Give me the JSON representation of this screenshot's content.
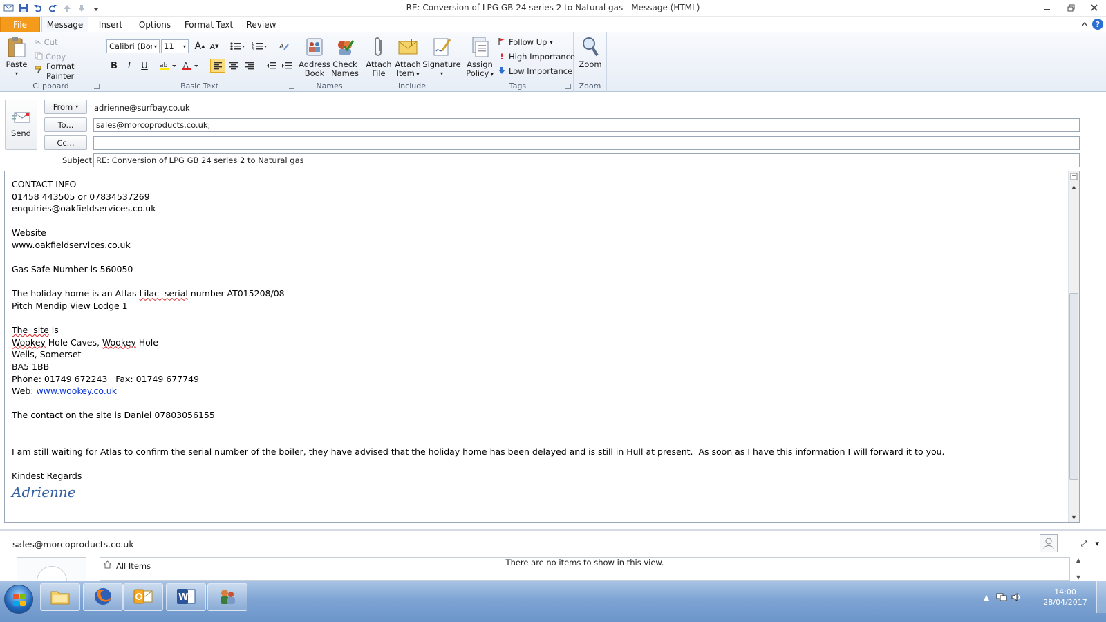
{
  "window": {
    "title": "RE: Conversion of LPG GB 24 series 2 to Natural gas  -  Message (HTML)"
  },
  "tabs": [
    "File",
    "Message",
    "Insert",
    "Options",
    "Format Text",
    "Review"
  ],
  "ribbon": {
    "clipboard": {
      "label": "Clipboard",
      "paste": "Paste",
      "cut": "Cut",
      "copy": "Copy",
      "format_painter": "Format Painter"
    },
    "basic_text": {
      "label": "Basic Text",
      "font_name": "Calibri (Body)",
      "font_size": "11"
    },
    "names": {
      "label": "Names",
      "address_book": [
        "Address",
        "Book"
      ],
      "check_names": [
        "Check",
        "Names"
      ]
    },
    "include": {
      "label": "Include",
      "attach_file": [
        "Attach",
        "File"
      ],
      "attach_item": [
        "Attach",
        "Item"
      ],
      "signature": "Signature"
    },
    "tags": {
      "label": "Tags",
      "assign_policy": [
        "Assign",
        "Policy"
      ],
      "follow_up": "Follow Up",
      "high_importance": "High Importance",
      "low_importance": "Low Importance"
    },
    "zoom": {
      "label": "Zoom",
      "zoom": "Zoom"
    }
  },
  "header": {
    "send": "Send",
    "from_label": "From",
    "from_value": "adrienne@surfbay.co.uk",
    "to_label": "To...",
    "to_value": "sales@morcoproducts.co.uk;",
    "cc_label": "Cc...",
    "cc_value": "",
    "subject_label": "Subject:",
    "subject_value": "RE: Conversion of LPG GB 24 series 2 to Natural gas"
  },
  "body": {
    "contact_heading": "CONTACT INFO",
    "phones": "01458 443505 or 07834537269",
    "email": "enquiries@oakfieldservices.co.uk",
    "website_heading": "Website",
    "website": "www.oakfieldservices.co.uk",
    "gas_safe": "Gas Safe Number is 560050",
    "holiday_a": "The holiday home is an Atlas ",
    "holiday_b": "Lilac  serial",
    "holiday_c": " number AT015208/08",
    "pitch": "Pitch Mendip View Lodge 1",
    "site_a": "The  site",
    "site_b": " is",
    "addr1_a": "Wookey",
    "addr1_b": " Hole Caves, ",
    "addr1_c": "Wookey",
    "addr1_d": " Hole",
    "addr2": "Wells, Somerset",
    "addr3": "BA5 1BB",
    "phone_fax": "Phone: 01749 672243   Fax: 01749 677749",
    "web_label": "Web: ",
    "web_link": "www.wookey.co.uk",
    "contact_site": "The contact on the site is Daniel 07803056155",
    "waiting": "I am still waiting for Atlas to confirm the serial number of the boiler, they have advised that the holiday home has been delayed and is still in Hull at present.  As soon as I have this information I will forward it to you.",
    "regards": "Kindest Regards",
    "signature": "Adrienne"
  },
  "people_pane": {
    "contact": "sales@morcoproducts.co.uk",
    "all_items": "All Items",
    "no_items": "There are no items to show in this view."
  },
  "taskbar": {
    "apps": [
      "file-explorer",
      "firefox",
      "outlook",
      "word",
      "people-app"
    ],
    "time": "14:00",
    "date": "28/04/2017"
  }
}
